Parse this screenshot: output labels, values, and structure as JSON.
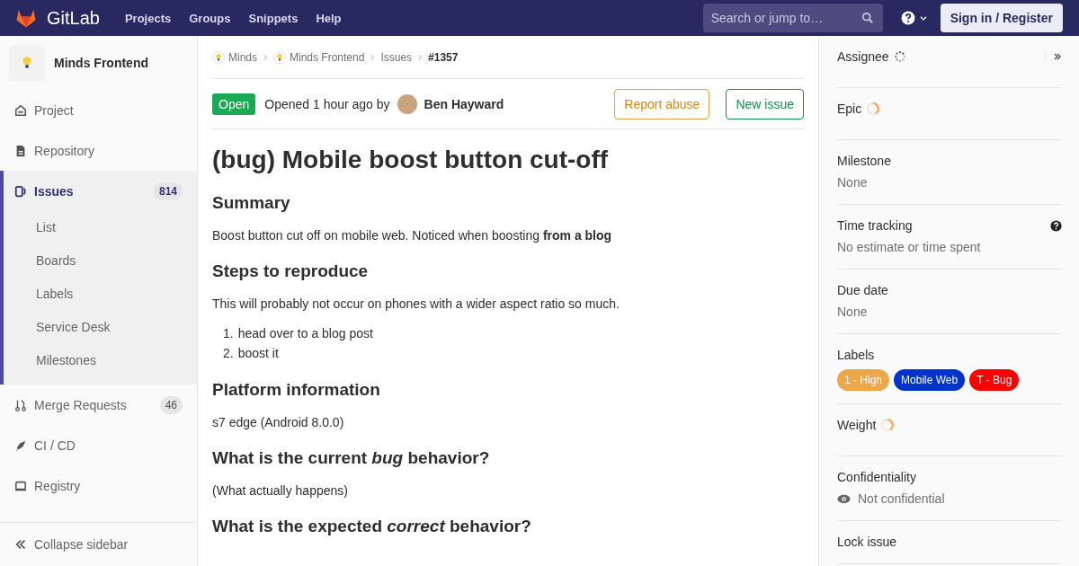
{
  "header": {
    "logo_text": "GitLab",
    "nav": [
      "Projects",
      "Groups",
      "Snippets",
      "Help"
    ],
    "search": {
      "placeholder": "Search or jump to…"
    },
    "sign_in": "Sign in / Register"
  },
  "sidebar": {
    "project": "Minds Frontend",
    "items": [
      {
        "label": "Project",
        "selected": false
      },
      {
        "label": "Repository",
        "selected": false
      },
      {
        "label": "Issues",
        "count": "814",
        "selected": true,
        "children": [
          {
            "label": "List"
          },
          {
            "label": "Boards"
          },
          {
            "label": "Labels"
          },
          {
            "label": "Service Desk"
          },
          {
            "label": "Milestones"
          }
        ]
      },
      {
        "label": "Merge Requests",
        "count": "46",
        "selected": false
      },
      {
        "label": "CI / CD",
        "selected": false
      },
      {
        "label": "Registry",
        "selected": false
      }
    ],
    "collapse": "Collapse sidebar"
  },
  "breadcrumbs": [
    {
      "label": "Minds",
      "avatar": true
    },
    {
      "label": "Minds Frontend",
      "avatar": true
    },
    {
      "label": "Issues",
      "avatar": false
    },
    {
      "label": "#1357",
      "avatar": false
    }
  ],
  "issue": {
    "status": "Open",
    "opened": "Opened 1 hour ago by",
    "author": "Ben Hayward",
    "buttons": [
      {
        "label": "Report abuse",
        "kind": "warning"
      },
      {
        "label": "New issue",
        "kind": "success"
      }
    ],
    "title": "(bug) Mobile boost button cut-off",
    "body": [
      {
        "kind": "heading",
        "text": "Summary"
      },
      {
        "kind": "paragraph",
        "text": "Boost button cut off on mobile web. Noticed when boosting **from a blog**"
      },
      {
        "kind": "heading",
        "text": "Steps to reproduce"
      },
      {
        "kind": "paragraph",
        "text": "This will probably not occur on phones with a wider aspect ratio so much."
      },
      {
        "kind": "list",
        "items": [
          {
            "marker": "1.",
            "text": "head over to a blog post"
          },
          {
            "marker": "2.",
            "text": "boost it"
          }
        ]
      },
      {
        "kind": "heading",
        "text": "Platform information"
      },
      {
        "kind": "paragraph",
        "text": "s7 edge (Android 8.0.0)"
      },
      {
        "kind": "heading",
        "text": "What is the current *bug* behavior?"
      },
      {
        "kind": "paragraph",
        "text": "(What actually happens)"
      },
      {
        "kind": "heading",
        "text": "What is the expected *correct* behavior?"
      }
    ]
  },
  "right_sidebar": [
    {
      "kind": "loading-dots",
      "title": "Assignee",
      "collapse": true
    },
    {
      "kind": "loading-arc",
      "title": "Epic"
    },
    {
      "kind": "value",
      "title": "Milestone",
      "value": "None"
    },
    {
      "kind": "value",
      "title": "Time tracking",
      "value": "No estimate or time spent",
      "help": true
    },
    {
      "kind": "value",
      "title": "Due date",
      "value": "None"
    },
    {
      "kind": "labels",
      "title": "Labels",
      "labels": [
        {
          "text": "1 - High",
          "color": "#eea64a"
        },
        {
          "text": "Mobile Web",
          "color": "#0033cc"
        },
        {
          "text": "T - Bug",
          "color": "#ff0000"
        }
      ]
    },
    {
      "kind": "loading-arc",
      "title": "Weight"
    },
    {
      "kind": "value",
      "title": "Confidentiality",
      "value": "Not confidential",
      "eye": true
    },
    {
      "kind": "title",
      "title": "Lock issue"
    }
  ]
}
